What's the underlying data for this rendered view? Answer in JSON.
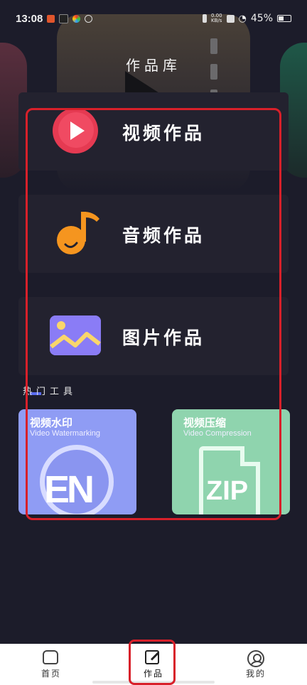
{
  "status_bar": {
    "time": "13:08",
    "net_speed_value": "0.00",
    "net_speed_unit": "KB/s",
    "battery": "45%",
    "battery_level": 0.45
  },
  "header": {
    "title": "作品库"
  },
  "categories": [
    {
      "label": "视频作品",
      "icon": "play-icon",
      "color": "#e53a52"
    },
    {
      "label": "音频作品",
      "icon": "music-note-icon",
      "color": "#f5951f"
    },
    {
      "label": "图片作品",
      "icon": "image-icon",
      "color": "#8a7cf6"
    }
  ],
  "tools_section": {
    "label": "热门工具"
  },
  "tools": [
    {
      "title": "视频水印",
      "subtitle": "Video Watermarking",
      "icon_text": "EN",
      "color": "#8f9cf4"
    },
    {
      "title": "视频压缩",
      "subtitle": "Video Compression",
      "icon_text": "ZIP",
      "color": "#8fd4ae"
    }
  ],
  "bottom_nav": [
    {
      "label": "首页",
      "icon": "home-icon"
    },
    {
      "label": "作品",
      "icon": "edit-icon",
      "active": true
    },
    {
      "label": "我的",
      "icon": "profile-icon"
    }
  ]
}
